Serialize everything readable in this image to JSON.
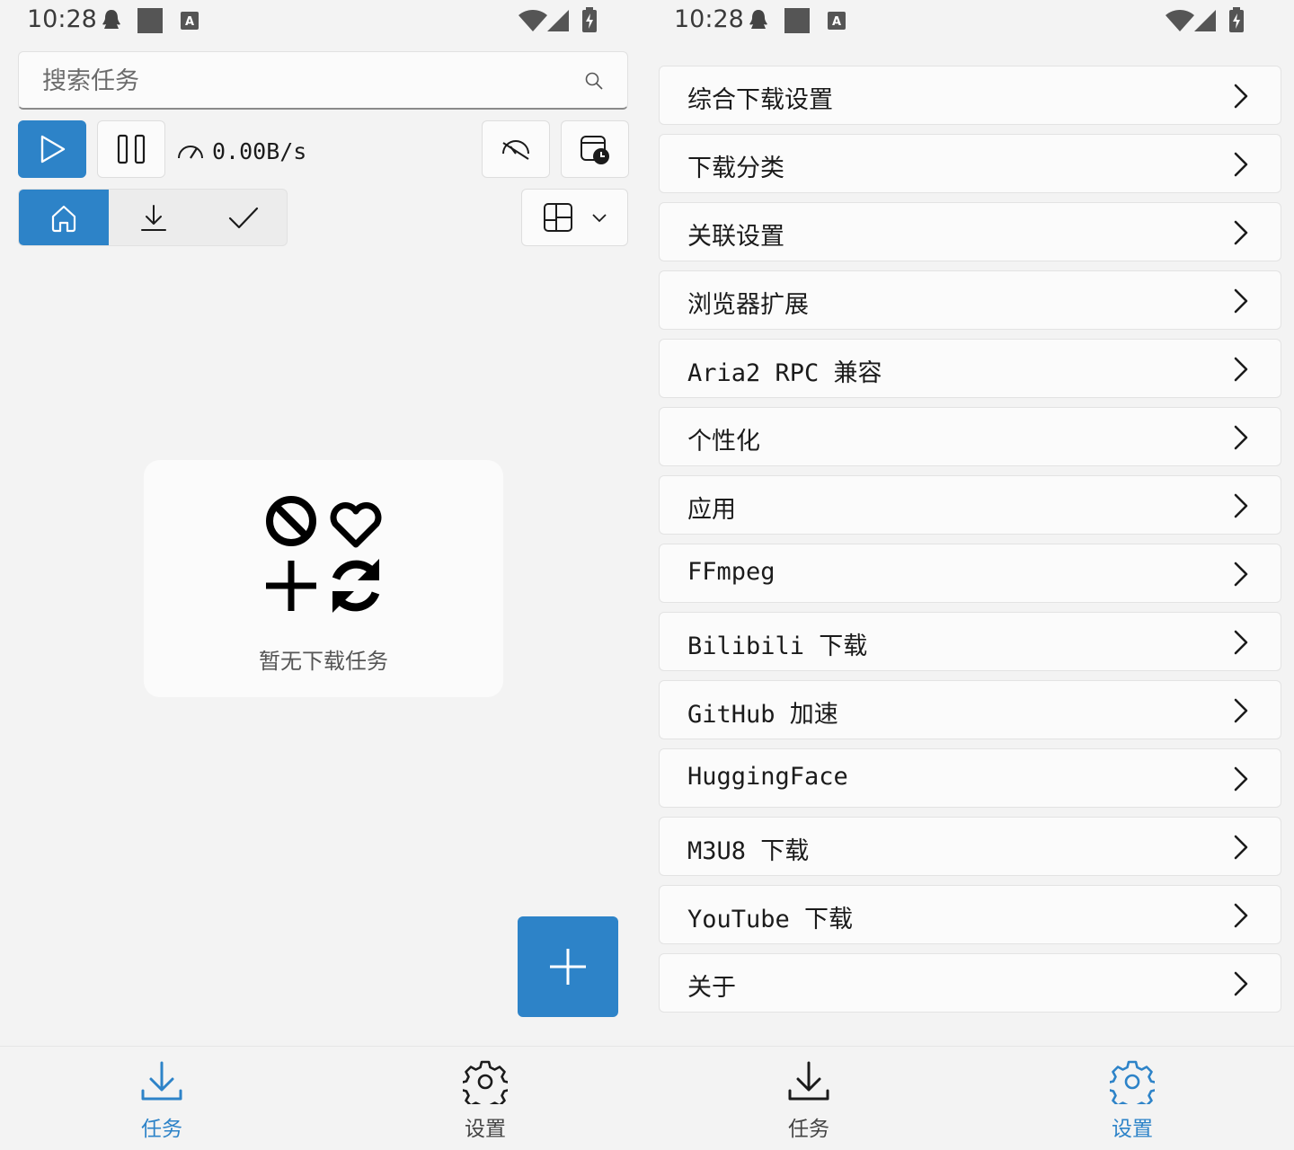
{
  "left": {
    "status": {
      "time": "10:28"
    },
    "search": {
      "placeholder": "搜索任务"
    },
    "toolbar": {
      "speed": "0.00B/s"
    },
    "empty_state": {
      "text": "暂无下载任务"
    },
    "nav": [
      {
        "label": "任务",
        "icon": "download-icon",
        "active": true
      },
      {
        "label": "设置",
        "icon": "gear-icon",
        "active": false
      }
    ]
  },
  "right": {
    "status": {
      "time": "10:28"
    },
    "settings": [
      {
        "label": "综合下载设置"
      },
      {
        "label": "下载分类"
      },
      {
        "label": "关联设置"
      },
      {
        "label": "浏览器扩展"
      },
      {
        "label": "Aria2 RPC 兼容"
      },
      {
        "label": "个性化"
      },
      {
        "label": "应用"
      },
      {
        "label": "FFmpeg"
      },
      {
        "label": "Bilibili 下载"
      },
      {
        "label": "GitHub 加速"
      },
      {
        "label": "HuggingFace"
      },
      {
        "label": "M3U8 下载"
      },
      {
        "label": "YouTube 下载"
      },
      {
        "label": "关于"
      }
    ],
    "nav": [
      {
        "label": "任务",
        "icon": "download-icon",
        "active": false
      },
      {
        "label": "设置",
        "icon": "gear-icon",
        "active": true
      }
    ]
  },
  "colors": {
    "accent": "#2d83c8",
    "background": "#f3f3f3",
    "card": "#fbfbfb"
  }
}
